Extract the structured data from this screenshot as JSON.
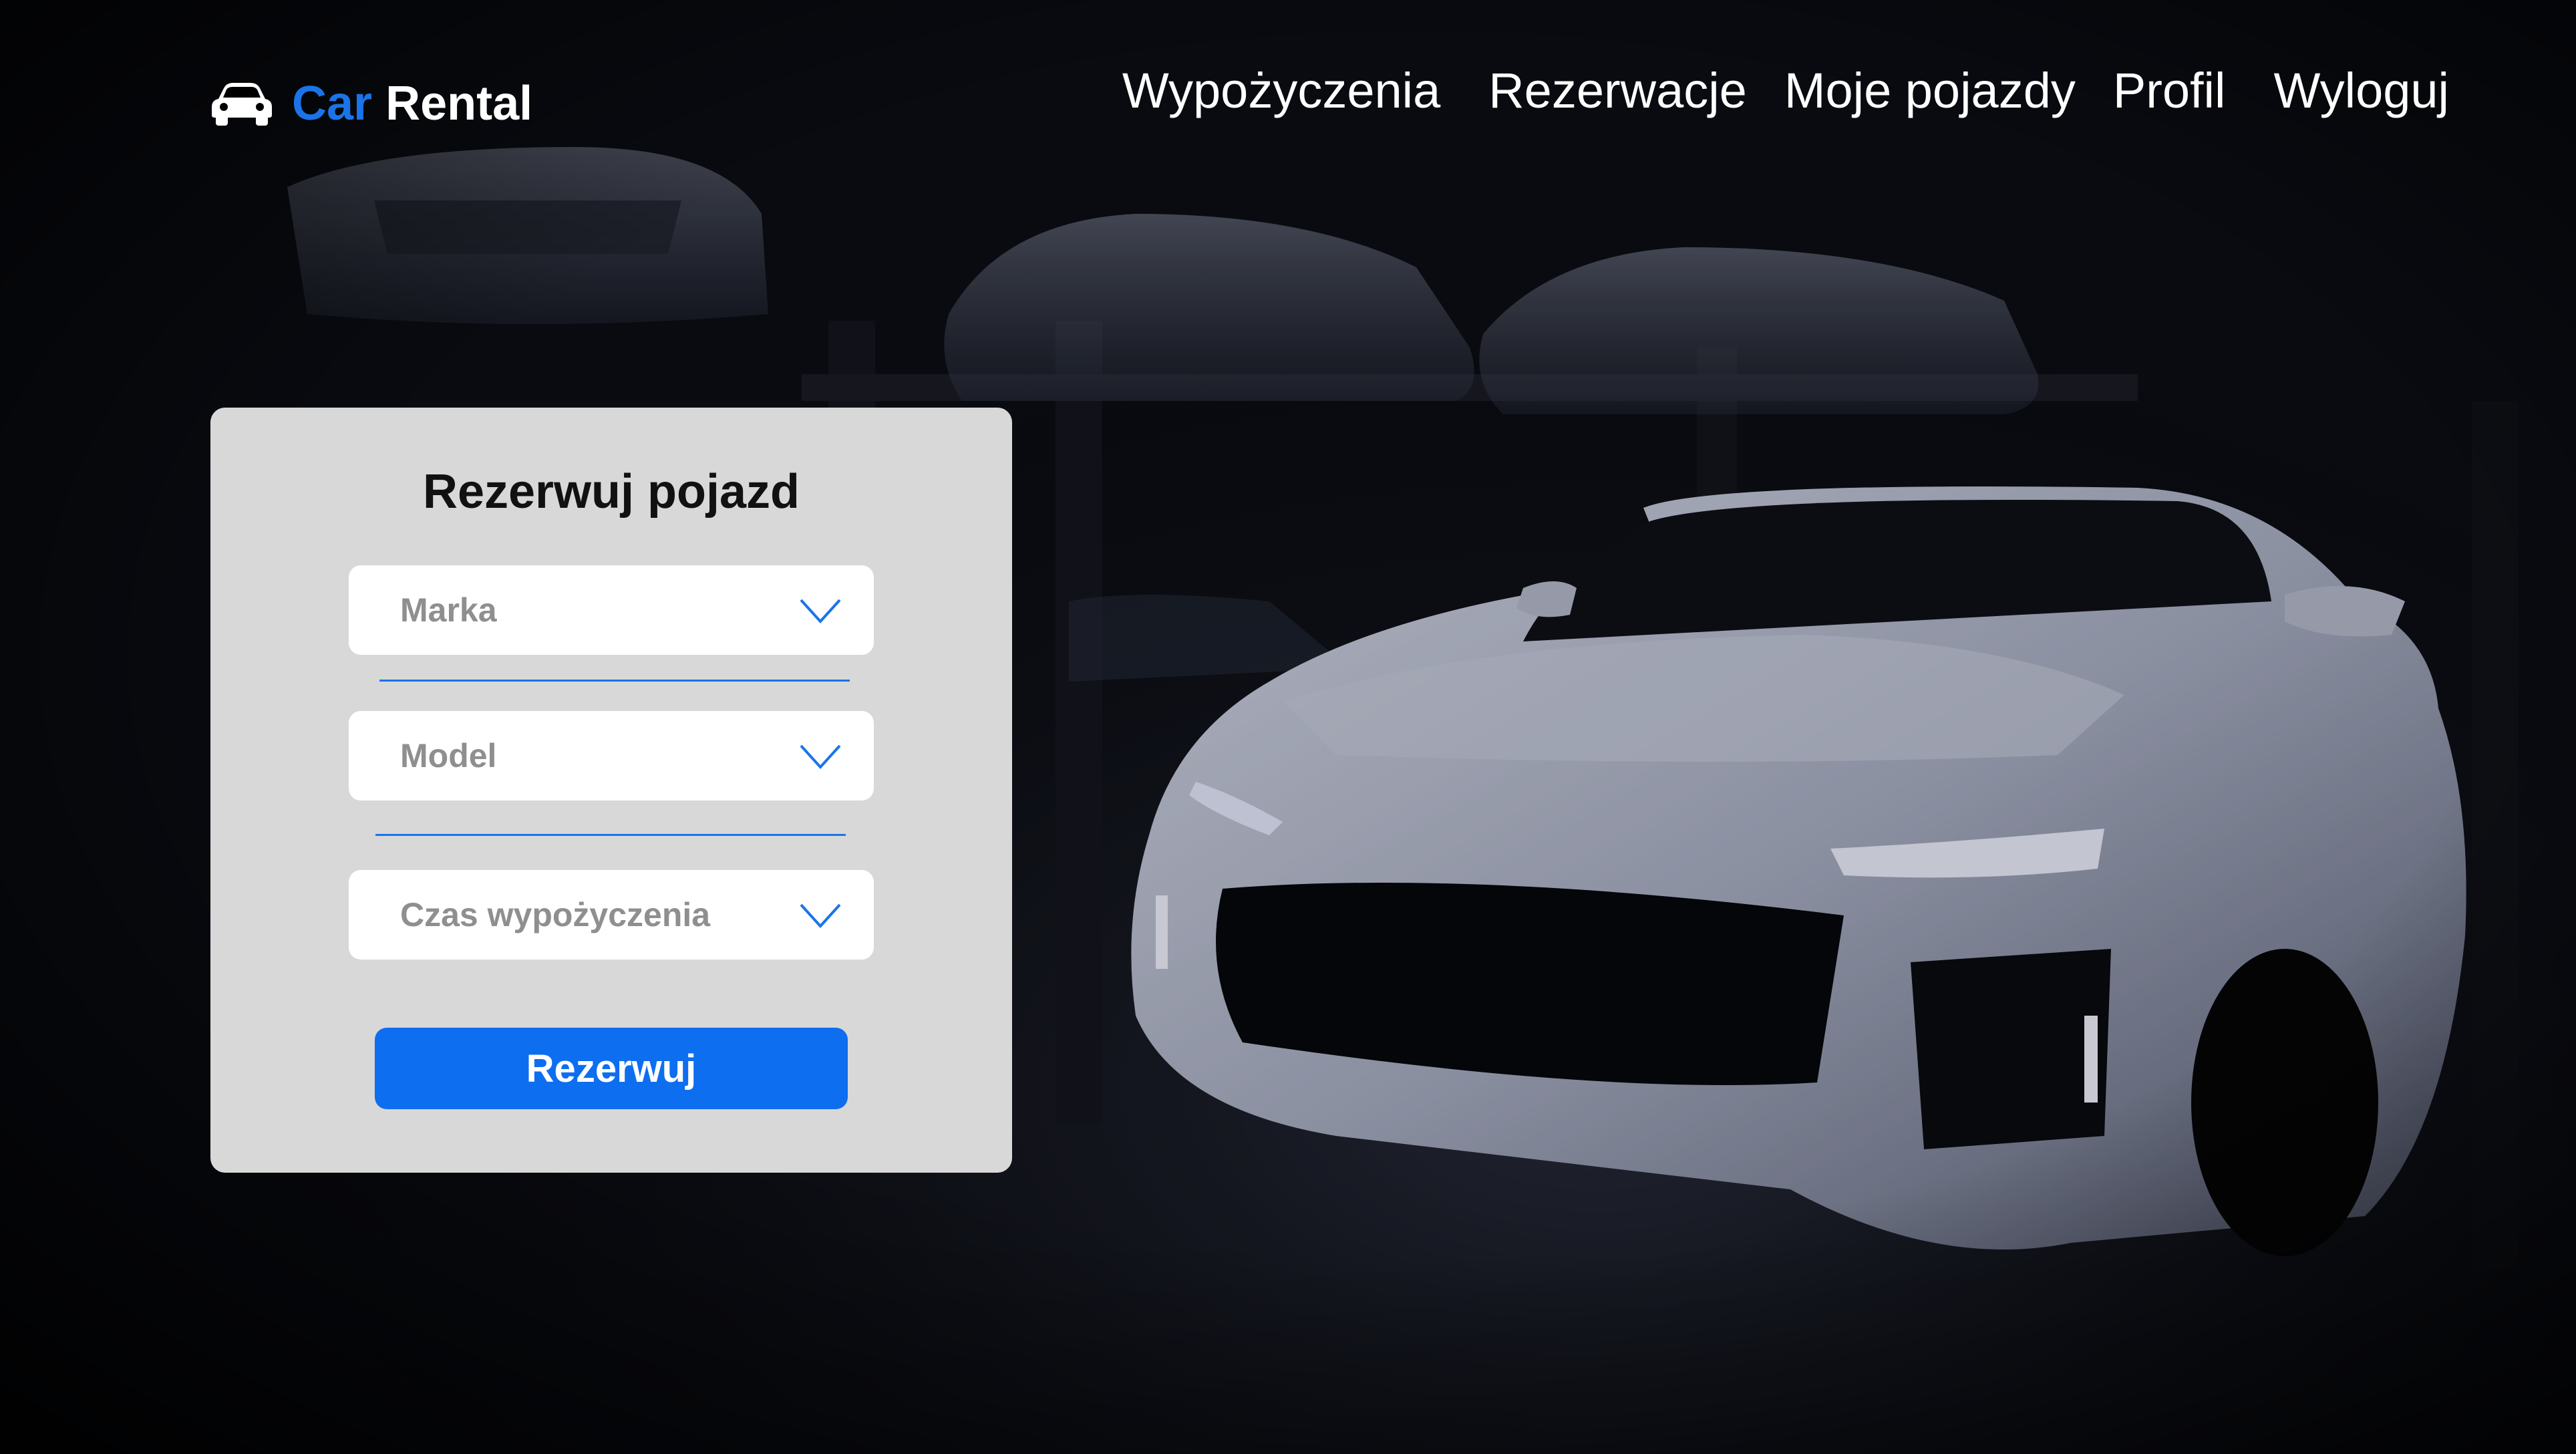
{
  "brand": {
    "name_part1": "Car",
    "name_part2": "Rental",
    "accent_color": "#1a74e8",
    "icon": "car-icon"
  },
  "nav": {
    "items": [
      {
        "label": "Wypożyczenia"
      },
      {
        "label": "Rezerwacje"
      },
      {
        "label": "Moje pojazdy"
      },
      {
        "label": "Profil"
      },
      {
        "label": "Wyloguj"
      }
    ]
  },
  "hero": {
    "image": "dark-garage-with-white-sports-cars-photo"
  },
  "booking_form": {
    "title": "Rezerwuj pojazd",
    "fields": [
      {
        "placeholder": "Marka",
        "icon": "chevron-down-icon"
      },
      {
        "placeholder": "Model",
        "icon": "chevron-down-icon"
      },
      {
        "placeholder": "Czas wypożyczenia",
        "icon": "chevron-down-icon"
      }
    ],
    "submit_label": "Rezerwuj",
    "card_color": "#d8d8d8",
    "button_color": "#0d6ef0"
  }
}
